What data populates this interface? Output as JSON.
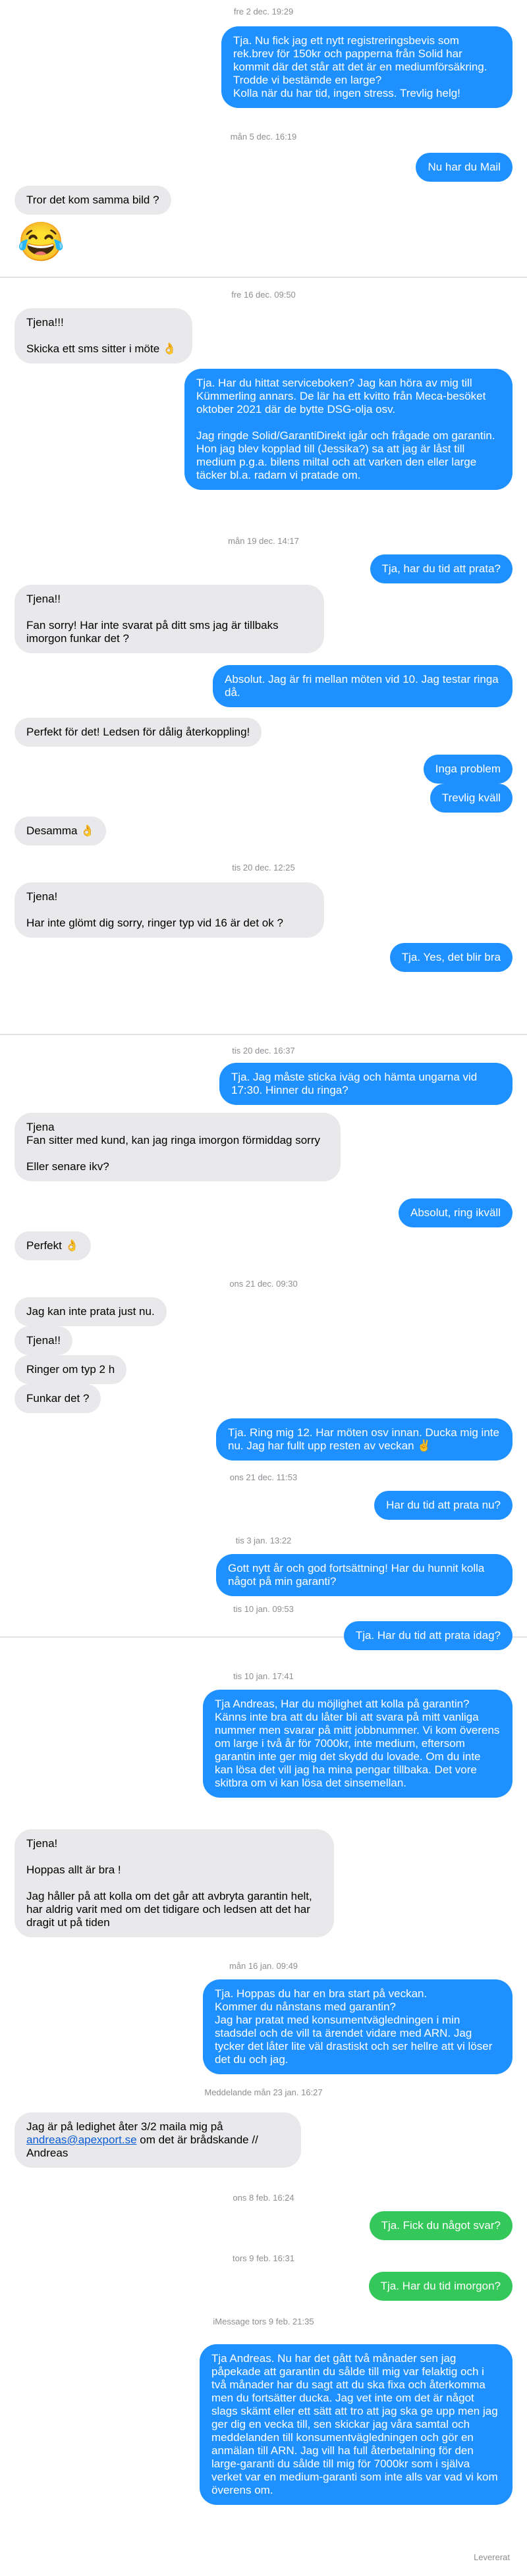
{
  "conversation": [
    {
      "kind": "ts",
      "text": "fre 2 dec. 19:29"
    },
    {
      "kind": "out",
      "text": "Tja. Nu fick jag ett nytt registreringsbevis som rek.brev för 150kr och papperna från Solid har kommit där det står att det är en mediumförsäkring. Trodde vi bestämde en large?\nKolla när du har tid, ingen stress. Trevlig helg!"
    },
    {
      "kind": "ts",
      "text": "mån 5 dec. 16:19"
    },
    {
      "kind": "out",
      "text": "Nu har du Mail"
    },
    {
      "kind": "in",
      "text": "Tror det kom samma bild ?"
    },
    {
      "kind": "emoji",
      "text": "😂"
    },
    {
      "kind": "ts",
      "text": "fre 16 dec. 09:50"
    },
    {
      "kind": "in",
      "text": "Tjena!!!\n\nSkicka ett sms sitter i möte 👌"
    },
    {
      "kind": "out",
      "text": "Tja. Har du hittat serviceboken? Jag kan höra av mig till Kümmerling annars. De lär ha ett kvitto från Meca-besöket oktober 2021 där de bytte DSG-olja osv.\n\nJag ringde Solid/GarantiDirekt igår och frågade om garantin. Hon jag blev kopplad till (Jessika?) sa att jag är låst till medium p.g.a. bilens miltal och att varken den eller large täcker bl.a. radarn vi pratade om."
    },
    {
      "kind": "ts",
      "text": "mån 19 dec. 14:17"
    },
    {
      "kind": "out",
      "text": "Tja, har du tid att prata?"
    },
    {
      "kind": "in",
      "text": "Tjena!!\n\nFan sorry! Har inte svarat på ditt sms jag är tillbaks imorgon funkar det ?"
    },
    {
      "kind": "out",
      "text": "Absolut. Jag är fri mellan möten vid 10. Jag testar ringa då."
    },
    {
      "kind": "in",
      "text": "Perfekt för det! Ledsen för dålig återkoppling!"
    },
    {
      "kind": "out",
      "text": "Inga problem"
    },
    {
      "kind": "out",
      "text": "Trevlig kväll"
    },
    {
      "kind": "in",
      "text": "Desamma 👌"
    },
    {
      "kind": "ts",
      "text": "tis 20 dec. 12:25"
    },
    {
      "kind": "in",
      "text": "Tjena!\n\nHar inte glömt dig sorry, ringer typ vid 16 är det ok ?"
    },
    {
      "kind": "out",
      "text": "Tja. Yes, det blir bra"
    },
    {
      "kind": "ts",
      "text": "tis 20 dec. 16:37"
    },
    {
      "kind": "out",
      "text": "Tja. Jag måste sticka iväg och hämta ungarna vid 17:30. Hinner du ringa?"
    },
    {
      "kind": "in",
      "text": "Tjena\nFan sitter med kund, kan jag ringa imorgon förmiddag sorry\n\nEller senare ikv?"
    },
    {
      "kind": "out",
      "text": "Absolut, ring ikväll"
    },
    {
      "kind": "in",
      "text": "Perfekt 👌"
    },
    {
      "kind": "ts",
      "text": "ons 21 dec. 09:30"
    },
    {
      "kind": "in",
      "text": "Jag kan inte prata just nu."
    },
    {
      "kind": "in",
      "text": "Tjena!!"
    },
    {
      "kind": "in",
      "text": "Ringer om typ 2 h"
    },
    {
      "kind": "in",
      "text": "Funkar det ?"
    },
    {
      "kind": "out",
      "text": "Tja. Ring mig 12. Har möten osv innan. Ducka mig inte nu. Jag har fullt upp resten av veckan ✌️"
    },
    {
      "kind": "ts",
      "text": "ons 21 dec. 11:53"
    },
    {
      "kind": "out",
      "text": "Har du tid att prata nu?"
    },
    {
      "kind": "ts",
      "text": "tis 3 jan. 13:22"
    },
    {
      "kind": "out",
      "text": "Gott nytt år och god fortsättning! Har du hunnit kolla något på min garanti?"
    },
    {
      "kind": "ts",
      "text": "tis 10 jan. 09:53"
    },
    {
      "kind": "out",
      "text": "Tja. Har du tid att prata idag?"
    },
    {
      "kind": "ts",
      "text": "tis 10 jan. 17:41"
    },
    {
      "kind": "out",
      "text": "Tja Andreas, Har du möjlighet att kolla på garantin? Känns inte bra att du låter bli att svara på mitt vanliga nummer men svarar på mitt jobbnummer. Vi kom överens om large i två år för 7000kr, inte medium, eftersom garantin inte ger mig det skydd du lovade. Om du inte kan lösa det vill jag ha mina pengar tillbaka. Det vore skitbra om vi kan lösa det sinsemellan."
    },
    {
      "kind": "in",
      "text": "Tjena!\n\nHoppas allt är bra !\n\nJag håller på att kolla om det går att avbryta garantin helt, har aldrig varit med om det tidigare och ledsen att det har dragit ut på tiden"
    },
    {
      "kind": "ts",
      "text": "mån 16 jan. 09:49"
    },
    {
      "kind": "out",
      "text": "Tja. Hoppas du har en bra start på veckan.\nKommer du nånstans med garantin?\nJag har pratat med konsumentvägledningen i min stadsdel och de vill ta ärendet vidare med ARN. Jag tycker det låter lite väl drastiskt och ser hellre att vi löser det du och jag."
    },
    {
      "kind": "ts",
      "text": "Meddelande\nmån 23 jan. 16:27"
    },
    {
      "kind": "in",
      "text": "Jag är på ledighet åter 3/2 maila mig på andreas@apexport.se om det är brådskande //\nAndreas"
    },
    {
      "kind": "ts",
      "text": "ons 8 feb. 16:24"
    },
    {
      "kind": "sms",
      "text": "Tja. Fick du något svar?"
    },
    {
      "kind": "ts",
      "text": "tors 9 feb. 16:31"
    },
    {
      "kind": "sms",
      "text": "Tja. Har du tid imorgon?"
    },
    {
      "kind": "ts",
      "text": "iMessage\ntors 9 feb. 21:35"
    },
    {
      "kind": "out",
      "text": "Tja Andreas. Nu har det gått två månader sen jag påpekade att garantin du sålde till mig var felaktig och i två månader har du sagt att du ska fixa och återkomma men du fortsätter ducka. Jag vet inte om det är något slags skämt eller ett sätt att tro att jag ska ge upp men jag ger dig en vecka till, sen skickar jag våra samtal och meddelanden till konsumentvägledningen och gör en anmälan till ARN. Jag vill ha full återbetalning för den large-garanti du sålde till mig för 7000kr som i själva verket var en medium-garanti som inte alls var vad vi kom överens om."
    }
  ],
  "status": {
    "delivered": "Levererat"
  }
}
